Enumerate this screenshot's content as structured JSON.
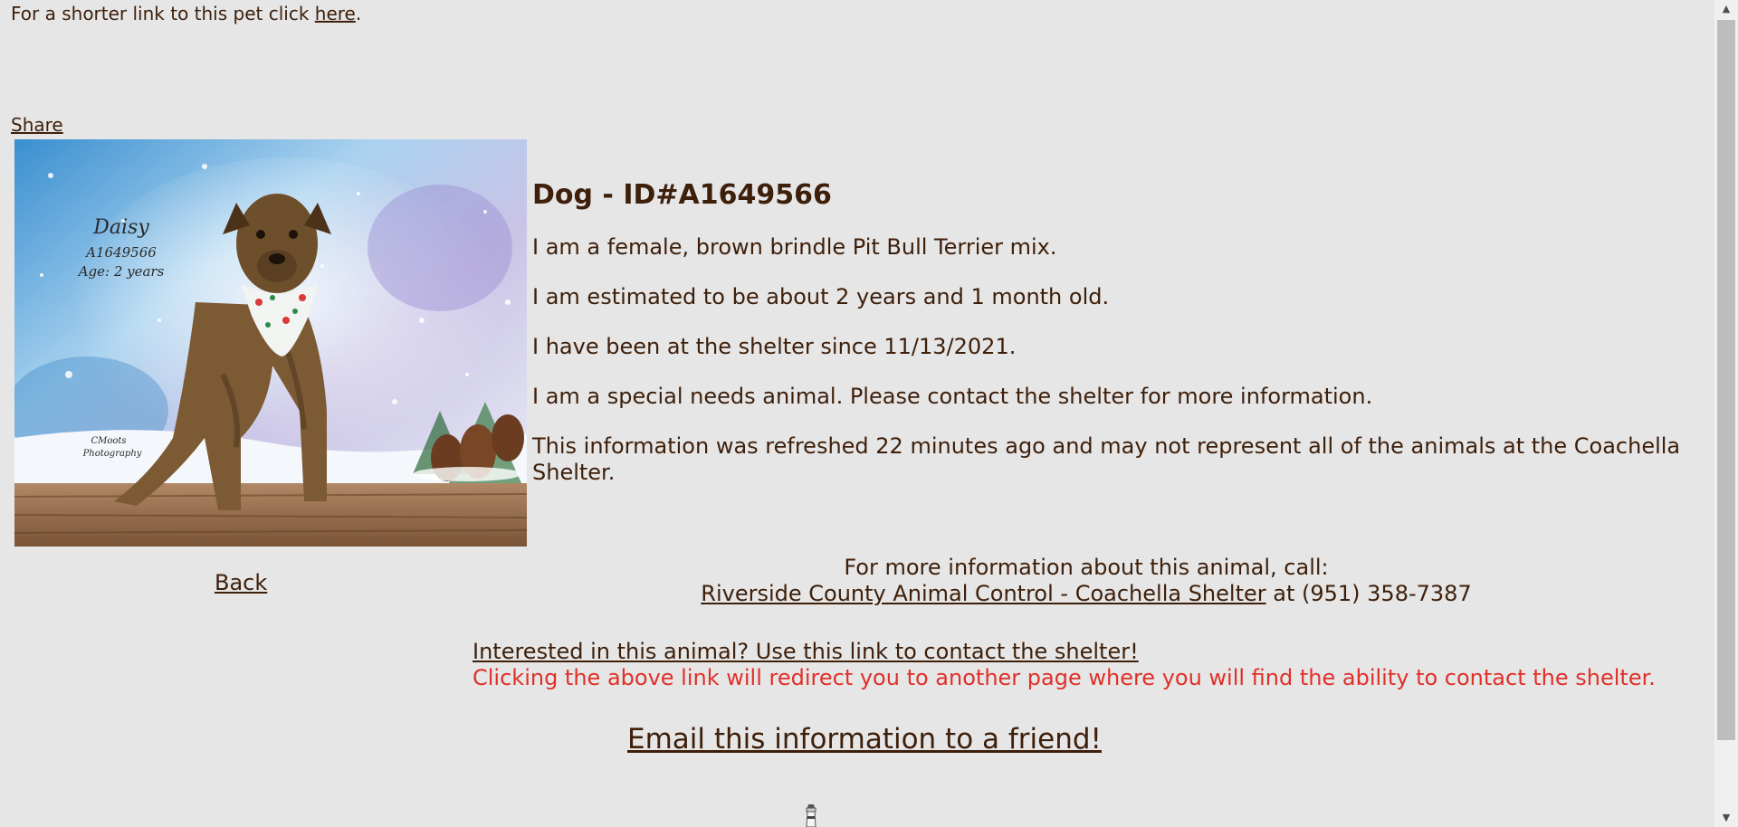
{
  "header": {
    "shorter_link_text": "For a shorter link to this pet click ",
    "shorter_link_label": "here",
    "shorter_link_suffix": "."
  },
  "share_label": "Share",
  "photo": {
    "name": "Daisy",
    "id": "A1649566",
    "age": "Age: 2 years",
    "credit_line1": "CMoots",
    "credit_line2": "Photography"
  },
  "back_label": "Back",
  "details": {
    "title": "Dog - ID#A1649566",
    "line1": "I am a female, brown brindle Pit Bull Terrier mix.",
    "line2": "I am estimated to be about 2 years and 1 month old.",
    "line3": "I have been at the shelter since 11/13/2021.",
    "line4": "I am a special needs animal. Please contact the shelter for more information.",
    "line5": "This information was refreshed 22 minutes ago and may not represent all of the animals at the Coachella Shelter."
  },
  "contact": {
    "intro": "For more information about this animal, call:",
    "shelter_link": "Riverside County Animal Control - Coachella Shelter",
    "phone_text": " at (951) 358-7387"
  },
  "interest": {
    "link": "Interested in this animal? Use this link to contact the shelter!",
    "note": "Clicking the above link will redirect you to another page where you will find the ability to contact the shelter."
  },
  "email_label": "Email this information to a friend!",
  "colors": {
    "background": "#e6e6e6",
    "text": "#3d1f0a",
    "warning": "#e0302a"
  }
}
